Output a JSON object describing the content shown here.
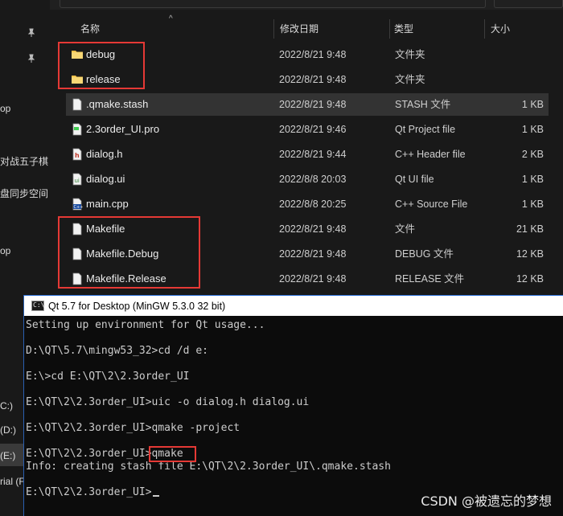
{
  "nav": {
    "items": [
      {
        "label": "op"
      },
      {
        "label": "对战五子棋"
      },
      {
        "label": "盘同步空间"
      },
      {
        "label": "op"
      },
      {
        "label": "C:)"
      },
      {
        "label": "(D:)"
      },
      {
        "label": "(E:)"
      },
      {
        "label": "rial (F"
      }
    ]
  },
  "columns": {
    "name": "名称",
    "date": "修改日期",
    "type": "类型",
    "size": "大小"
  },
  "files": [
    {
      "name": "debug",
      "date": "2022/8/21 9:48",
      "type": "文件夹",
      "size": "",
      "icon": "folder-icon"
    },
    {
      "name": "release",
      "date": "2022/8/21 9:48",
      "type": "文件夹",
      "size": "",
      "icon": "folder-icon"
    },
    {
      "name": ".qmake.stash",
      "date": "2022/8/21 9:48",
      "type": "STASH 文件",
      "size": "1 KB",
      "icon": "file-icon"
    },
    {
      "name": "2.3order_UI.pro",
      "date": "2022/8/21 9:46",
      "type": "Qt Project file",
      "size": "1 KB",
      "icon": "qt-pro-file-icon"
    },
    {
      "name": "dialog.h",
      "date": "2022/8/21 9:44",
      "type": "C++ Header file",
      "size": "2 KB",
      "icon": "header-file-icon"
    },
    {
      "name": "dialog.ui",
      "date": "2022/8/8 20:03",
      "type": "Qt UI file",
      "size": "1 KB",
      "icon": "qt-ui-file-icon"
    },
    {
      "name": "main.cpp",
      "date": "2022/8/8 20:25",
      "type": "C++ Source File",
      "size": "1 KB",
      "icon": "cpp-file-icon"
    },
    {
      "name": "Makefile",
      "date": "2022/8/21 9:48",
      "type": "文件",
      "size": "21 KB",
      "icon": "file-icon"
    },
    {
      "name": "Makefile.Debug",
      "date": "2022/8/21 9:48",
      "type": "DEBUG 文件",
      "size": "12 KB",
      "icon": "file-icon"
    },
    {
      "name": "Makefile.Release",
      "date": "2022/8/21 9:48",
      "type": "RELEASE 文件",
      "size": "12 KB",
      "icon": "file-icon"
    }
  ],
  "terminal": {
    "title": "Qt 5.7 for Desktop (MinGW 5.3.0 32 bit)",
    "icon_text": "C:\\",
    "lines": [
      "Setting up environment for Qt usage...",
      "D:\\QT\\5.7\\mingw53_32>cd /d e:",
      "E:\\>cd E:\\QT\\2\\2.3order_UI",
      "E:\\QT\\2\\2.3order_UI>uic -o dialog.h dialog.ui",
      "E:\\QT\\2\\2.3order_UI>qmake -project",
      "E:\\QT\\2\\2.3order_UI>qmake",
      "Info: creating stash file E:\\QT\\2\\2.3order_UI\\.qmake.stash",
      "E:\\QT\\2\\2.3order_UI>"
    ]
  },
  "watermark": "CSDN @被遗忘的梦想",
  "colors": {
    "highlight_box": "#e53935",
    "folder": "#f3c24b",
    "terminal_bg": "#0c0c0c"
  }
}
